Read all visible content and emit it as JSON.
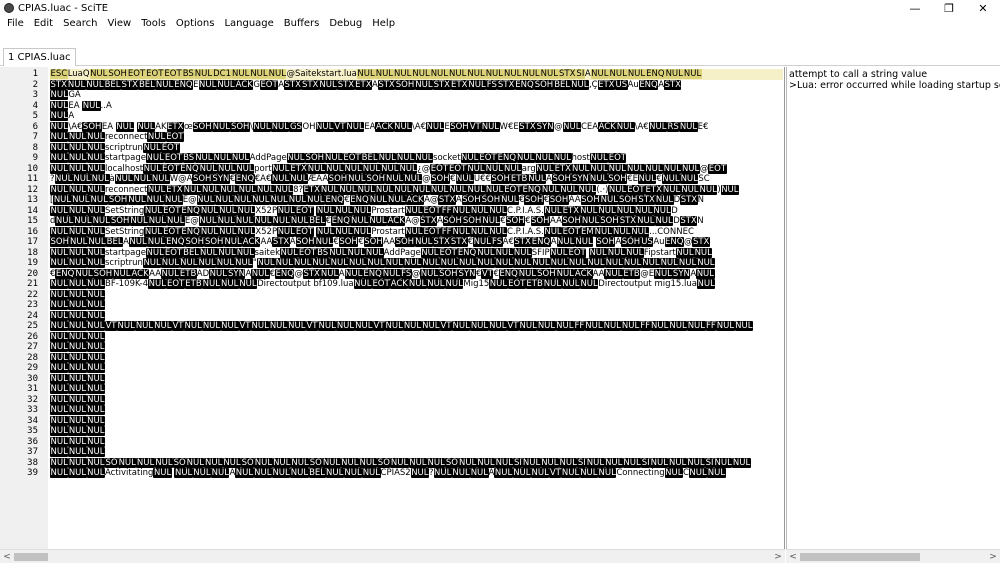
{
  "window": {
    "title": "CPIAS.luac - SciTE",
    "minimize_glyph": "—",
    "maximize_glyph": "❐",
    "close_glyph": "✕"
  },
  "menu": [
    "File",
    "Edit",
    "Search",
    "View",
    "Tools",
    "Options",
    "Language",
    "Buffers",
    "Debug",
    "Help"
  ],
  "tab": {
    "label": "1 CPIAS.luac"
  },
  "editor": {
    "lines": [
      {
        "n": "1",
        "text": "ESCLuaQNULSOHEOTEOTEOTBSNULDC1NULNULNUL@Saitekstart.luaNULNULNULNULNULNULNULNULNULNULNULSTXSIANULNULNULENQNULNUL"
      },
      {
        "n": "2",
        "text": "STXNULNULBELSTXBELNULENQENULNULACKGEOTASTXSTXNULSTXETXASTXSOHNULSTXETXNULFSSTXENQSOHBELNUL,ÇETXUSAuENQASTX"
      },
      {
        "n": "3",
        "text": "NULGA"
      },
      {
        "n": "4",
        "text": "NULEÁ NUL..A"
      },
      {
        "n": "5",
        "text": "NULÄ"
      },
      {
        "n": "6",
        "text": "NUL\\A€SOHEÁ    NUL     NULAKETXœSOHNULSOH\\NULNULGSOHNULVTNULEAACKNUL\\A€NULESOHVTNULW€ESTXSYN@NULCEAACKNUL\\A€NULRSNULE€"
      },
      {
        "n": "7",
        "text": "NULNULNULreconnectNULEOT"
      },
      {
        "n": "8",
        "text": "NULNULNULscriptrunNULEOT"
      },
      {
        "n": "9",
        "text": "NULNULNULstartpageNULEOTBSNULNULNULAddPageNULSOHNULEOTBELNULNULNULsocketNULEOTENQNULNULNULhostNULEOT"
      },
      {
        "n": "10",
        "text": "NULNULNULlocalhostNULEOTENQNULNULNULportNULETXNULNULNULNULNULNUL¿@EOTEOTNULNULNULargNULETXNULNULNULNULNULNULNUL@EOT"
      },
      {
        "n": "11",
        "text": "?NULNULNULàNULNULNULW@ÀSOHSYN€ENQ€Â€NULNULÆÄÀSOHNULSOHNULNUL@SOH€NULU€€SOHETBNULÀSOHSYNNULSOH€ENUL€NULNULSC"
      },
      {
        "n": "12",
        "text": "NULNULNULreconnectNULETXNULNULNULNULNULNUL8?ETXNULNULNULNULNULNULNULNULNULNULEOTENQNULNULNUL(.·)NULEOTETXNULNULNUL)NUL"
      },
      {
        "n": "13",
        "text": "[NULNULNULSOHNULNULNULE@NULNULNULNULNULNULNULENQ€ENQNULNULACKA@STXASOHSOHNUL€SOH€SOHÀASOHNULSOHSTXNULDSTXN"
      },
      {
        "n": "14",
        "text": "NULNULNULSetStringNULEOTENQNULNULNULX52PNULEOT    NULNULNULProstartNULEOTFFNULNULNULC.P.I.A.S.NULETXNULNULNULNULNULD"
      },
      {
        "n": "15",
        "text": "dNULNULNULSOHNULNULNULE@NULNULNULNULNULNULBEL€ENQNULNULACKA@STXASOHSOHNUL€SOH€SOHÀASOHNULSOHSTXNULNULDSTXN"
      },
      {
        "n": "16",
        "text": "NULNULNULSetStringNULEOTENQNULNULNULX52PNULEOT    NULNULNULProstartNULEOTFFNULNULNULC.P.I.A.S.NULEOTEMNULNULNUL...CONNEC"
      },
      {
        "n": "17",
        "text": "SOHNULNULBELANULNULENQSOHSOHNULACKAASTXASOHNUL€SOH€SOHÀÀSOHNULSTXSTX€NULFSA€STXENQÀNULNUL  SOHÁSOHUSAuENQ@STX"
      },
      {
        "n": "18",
        "text": "NULNULNULstartpageNULEOTBELNULNULNULsaitekNULEOTBSNULNULNULAddPageNULEOTENQNULNULNULSFIPNULEOT    NULNULNULFipstartNULNUL"
      },
      {
        "n": "19",
        "text": "NULNULNULscriptrunNULNULNULNULNULNUL\"NULNULNULNULNULNULNULNULNULNULNULNULNULNULNULNULNULNULNULNULNULNULNULNULNUL"
      },
      {
        "n": "20",
        "text": "€ENQNULSOHNULACKAANULETBADNULSYNÀNUL€ENQ@STXNULANULENQNULFS@NULSOHSYN€VT€ENQNULSOHNULACKAANULETB@ENULSYNÀNUL"
      },
      {
        "n": "21",
        "text": "NULNULNULBF-109K-4NULEOTETBNULNULNULDirectoutput bf109.luaNULEOTACKNULNULNULMig15NULEOTETBNULNULNULDirectoutput mig15.luaNUL"
      },
      {
        "n": "22",
        "text": "NULNULNUL"
      },
      {
        "n": "23",
        "text": "NULNULNUL"
      },
      {
        "n": "24",
        "text": "NULNULNUL"
      },
      {
        "n": "25",
        "text": "NULNULNULVTNULNULNULVTNULNULNULVTNULNULNULVTNULNULNULVTNULNULNULVTNULNULNULVTNULNULNULFFNULNULNULFFNULNULNULFFNULNUL"
      },
      {
        "n": "26",
        "text": "NULNULNUL"
      },
      {
        "n": "27",
        "text": "NULNULNUL"
      },
      {
        "n": "28",
        "text": "NULNULNUL"
      },
      {
        "n": "29",
        "text": "NULNULNUL"
      },
      {
        "n": "30",
        "text": "NULNULNUL"
      },
      {
        "n": "31",
        "text": "NULNULNUL"
      },
      {
        "n": "32",
        "text": "NULNULNUL"
      },
      {
        "n": "33",
        "text": "NULNULNUL"
      },
      {
        "n": "34",
        "text": "NULNULNUL"
      },
      {
        "n": "35",
        "text": "NULNULNUL"
      },
      {
        "n": "36",
        "text": "NULNULNUL"
      },
      {
        "n": "37",
        "text": "NULNULNUL"
      },
      {
        "n": "38",
        "text": "NULNULNULSONULNULNULSONULNULNULSONULNULNULSONULNULNULSONULNULNULSONULNULNULSINULNULNULSINULNULNULSINULNULNULSINULNUL"
      },
      {
        "n": "39",
        "text": "NULNULNULActivitatingNUL NULNULNULANULNULNULNULBELNULNULNULCPIAS2NUL?NULNULNULANULNULNULVTNULNULNULConnectingNULCNULNUL"
      }
    ]
  },
  "output": {
    "lines": [
      "attempt to call a string value",
      ">Lua: error occurred while loading startup script"
    ]
  },
  "scrollbar": {
    "left_arrow": "<",
    "right_arrow": ">"
  }
}
